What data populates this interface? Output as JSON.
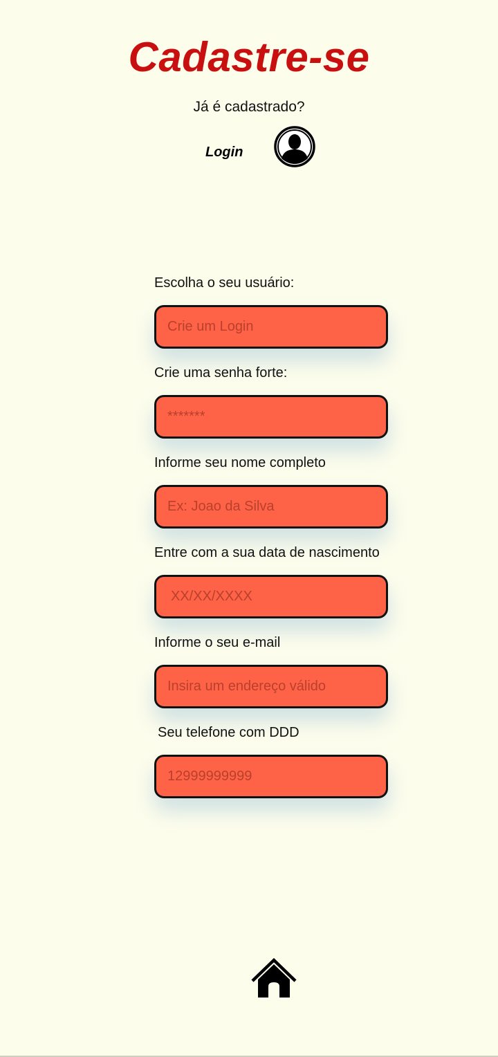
{
  "header": {
    "title": "Cadastre-se",
    "already_registered": "Já é cadastrado?",
    "login_label": "Login"
  },
  "form": {
    "fields": [
      {
        "label": "Escolha o seu usuário:",
        "placeholder": "Crie um Login",
        "value": ""
      },
      {
        "label": "Crie uma senha forte:",
        "placeholder": "*******",
        "value": ""
      },
      {
        "label": "Informe seu nome completo",
        "placeholder": "Ex: Joao da Silva",
        "value": ""
      },
      {
        "label": "Entre com a sua data de nascimento",
        "placeholder": "XX/XX/XXXX",
        "value": ""
      },
      {
        "label": "Informe o seu e-mail",
        "placeholder": "Insira um endereço válido",
        "value": ""
      },
      {
        "label": "Seu telefone com DDD",
        "placeholder": "12999999999",
        "value": ""
      }
    ]
  },
  "icons": {
    "login": "user-avatar-icon",
    "home": "home-icon"
  },
  "colors": {
    "background": "#fdfdec",
    "title": "#c81010",
    "input_fill": "#ff6347",
    "input_border": "#111111"
  }
}
